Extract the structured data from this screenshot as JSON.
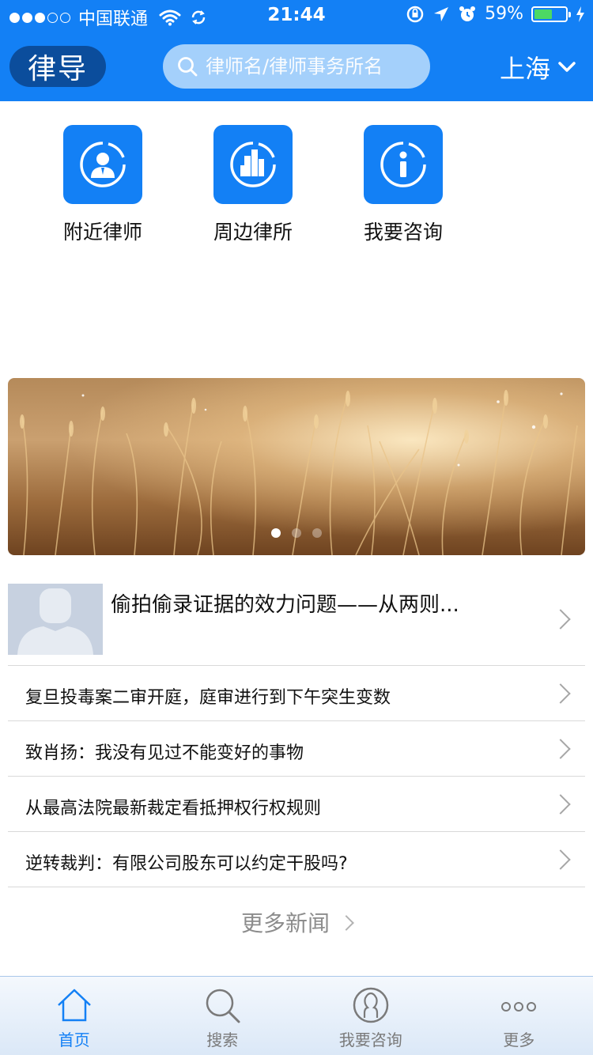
{
  "status_bar": {
    "carrier": "中国联通",
    "time": "21:44",
    "battery": "59%",
    "battery_level": 0.59,
    "signal_dots_filled": 3,
    "signal_dots_total": 5
  },
  "header": {
    "logo_text": "律导",
    "search_placeholder": "律师名/律师事务所名",
    "city": "上海"
  },
  "quick_actions": [
    {
      "label": "附近律师",
      "icon": "lawyer-person-icon"
    },
    {
      "label": "周边律所",
      "icon": "building-icon"
    },
    {
      "label": "我要咨询",
      "icon": "info-icon"
    }
  ],
  "banner": {
    "pages": 3,
    "active_page": 1
  },
  "news": {
    "featured": {
      "title": "偷拍偷录证据的效力问题——从两则..."
    },
    "items": [
      {
        "title": "复旦投毒案二审开庭，庭审进行到下午突生变数"
      },
      {
        "title": "致肖扬：我没有见过不能变好的事物"
      },
      {
        "title": "从最高法院最新裁定看抵押权行权规则"
      },
      {
        "title": "逆转裁判：有限公司股东可以约定干股吗?"
      }
    ],
    "more_label": "更多新闻"
  },
  "tabbar": {
    "items": [
      {
        "label": "首页",
        "icon": "home-icon",
        "active": true
      },
      {
        "label": "搜索",
        "icon": "search-icon",
        "active": false
      },
      {
        "label": "我要咨询",
        "icon": "consult-person-icon",
        "active": false
      },
      {
        "label": "更多",
        "icon": "more-dots-icon",
        "active": false
      }
    ]
  },
  "colors": {
    "brand_blue": "#1380f5",
    "logo_dark_blue": "#0b4d9c",
    "search_bg": "#a4d0fb"
  }
}
